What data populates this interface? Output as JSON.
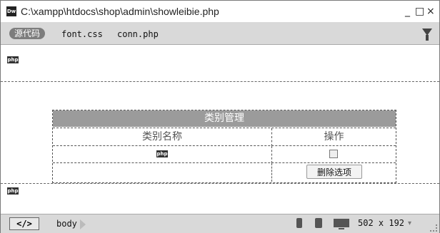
{
  "window": {
    "title": "C:\\xampp\\htdocs\\shop\\admin\\showleibie.php",
    "app_icon": "Dw",
    "controls": {
      "minimize": "_",
      "maximize": "□",
      "close": "×"
    }
  },
  "tabs": {
    "source_label": "源代码",
    "files": [
      "font.css",
      "conn.php"
    ]
  },
  "php_markers": [
    "php",
    "php",
    "php"
  ],
  "table": {
    "title": "类别管理",
    "column_left": "类别名称",
    "column_right": "操作",
    "row_php_label": "php",
    "delete_button": "删除选项"
  },
  "statusbar": {
    "code_label": "</>",
    "tag": "body",
    "viewport_size": "502 x 192",
    "dropdown_arrow": "▾"
  }
}
